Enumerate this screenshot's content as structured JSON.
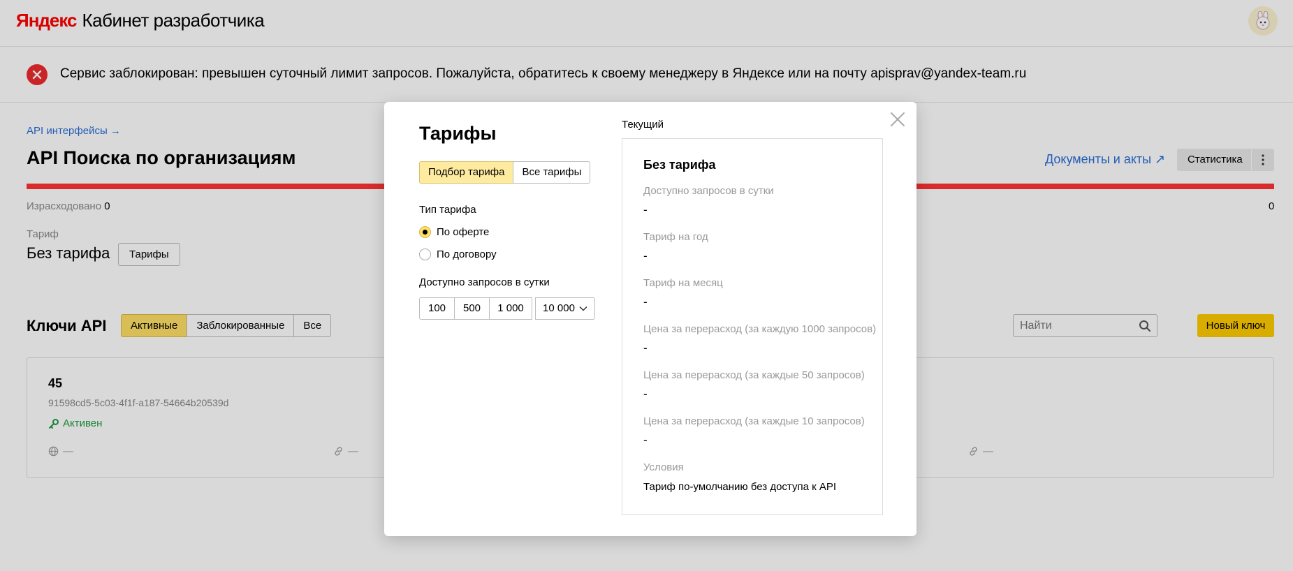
{
  "header": {
    "brand": "Яндекс",
    "product": "Кабинет разработчика"
  },
  "alert": {
    "message": "Сервис заблокирован: превышен суточный лимит запросов. Пожалуйста, обратитесь к своему менеджеру в Яндексе или на почту apisprav@yandex-team.ru"
  },
  "service": {
    "breadcrumb": "API интерфейсы →",
    "title": "API Поиска по организациям",
    "docs_link": "Документы и акты ↗",
    "stats_button": "Статистика",
    "usage_label": "Израсходовано",
    "usage_value": "0",
    "usage_max": "0",
    "tariff_caption": "Тариф",
    "tariff_value": "Без тарифа",
    "tariffs_button": "Тарифы"
  },
  "keys": {
    "title": "Ключи API",
    "filters": [
      "Активные",
      "Заблокированные",
      "Все"
    ],
    "active_filter": "Активные",
    "search_placeholder": "Найти",
    "new_key_button": "Новый ключ",
    "card": {
      "name": "45",
      "id": "91598cd5-5c03-4f1f-a187-54664b20539d",
      "status": "Активен",
      "meta": [
        "—",
        "—",
        "—"
      ]
    }
  },
  "modal": {
    "title": "Тарифы",
    "modes": [
      "Подбор тарифа",
      "Все тарифы"
    ],
    "tariff_type_label": "Тип тарифа",
    "radio_offer": "По оферте",
    "radio_contract": "По договору",
    "requests_label": "Доступно запросов в сутки",
    "requests_options": [
      "100",
      "500",
      "1 000"
    ],
    "requests_selected": "10 000",
    "current_caption": "Текущий",
    "plan": {
      "name": "Без тарифа",
      "rows": [
        {
          "label": "Доступно запросов в сутки",
          "value": "-"
        },
        {
          "label": "Тариф на год",
          "value": "-"
        },
        {
          "label": "Тариф на месяц",
          "value": "-"
        },
        {
          "label": "Цена за перерасход (за каждую 1000 запросов)",
          "value": "-"
        },
        {
          "label": "Цена за перерасход (за каждые 50 запросов)",
          "value": "-"
        },
        {
          "label": "Цена за перерасход (за каждые 10 запросов)",
          "value": "-"
        }
      ],
      "conditions_label": "Условия",
      "conditions_value": "Тариф по-умолчанию без доступа к API"
    }
  },
  "colors": {
    "brand_red": "#ff0000",
    "accent_yellow": "#ffcc00",
    "link_blue": "#2a6ed6",
    "usage_bar": "#ff3333",
    "status_green": "#1a9b3c"
  }
}
